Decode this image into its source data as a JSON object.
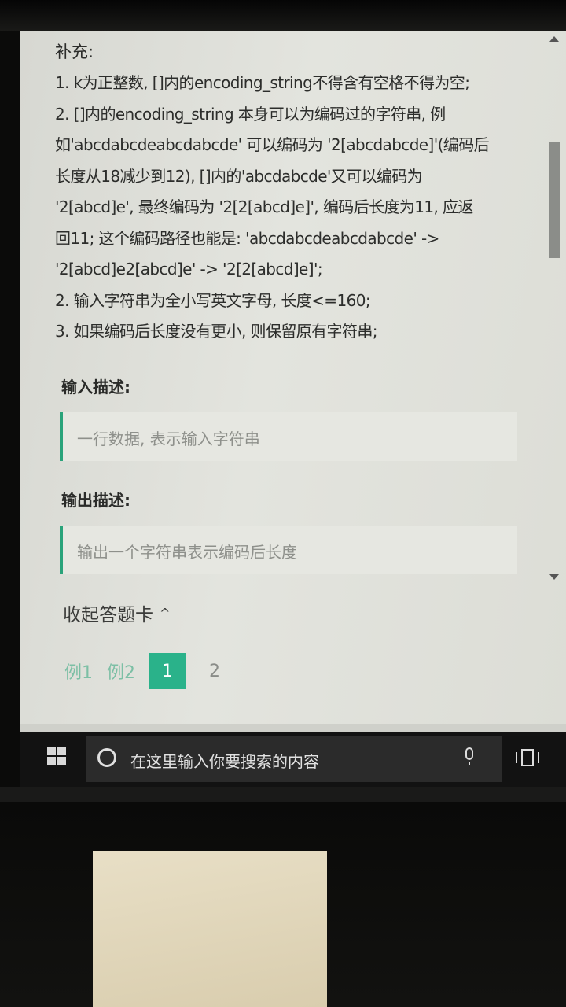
{
  "problem": {
    "supplement_heading": "补充:",
    "supplement_lines": [
      "1. k为正整数, []内的encoding_string不得含有空格不得为空;",
      "2. []内的encoding_string 本身可以为编码过的字符串, 例",
      "如'abcdabcdeabcdabcde' 可以编码为 '2[abcdabcde]'(编码后",
      "长度从18减少到12), []内的'abcdabcde'又可以编码为",
      "'2[abcd]e', 最终编码为 '2[2[abcd]e]', 编码后长度为11, 应返",
      "回11; 这个编码路径也能是: 'abcdabcdeabcdabcde' ->",
      "'2[abcd]e2[abcd]e' -> '2[2[abcd]e]';",
      "2. 输入字符串为全小写英文字母, 长度<=160;",
      "3. 如果编码后长度没有更小, 则保留原有字符串;"
    ],
    "input_title": "输入描述:",
    "input_desc": "一行数据, 表示输入字符串",
    "output_title": "输出描述:",
    "output_desc": "输出一个字符串表示编码后长度"
  },
  "answer_card": {
    "collapse_label": "收起答题卡",
    "collapse_icon": "chevron-up-icon",
    "tabs": [
      "例1",
      "例2"
    ],
    "active_page": "1",
    "next_page": "2"
  },
  "taskbar": {
    "start_icon": "windows-logo-icon",
    "search_placeholder": "在这里输入你要搜索的内容",
    "mic_icon": "microphone-icon",
    "taskview_icon": "task-view-icon"
  },
  "colors": {
    "accent": "#2ab28a",
    "quote_border": "#2aa37a",
    "text": "#2c2d2b",
    "muted": "#8e908b",
    "taskbar": "#121212"
  }
}
